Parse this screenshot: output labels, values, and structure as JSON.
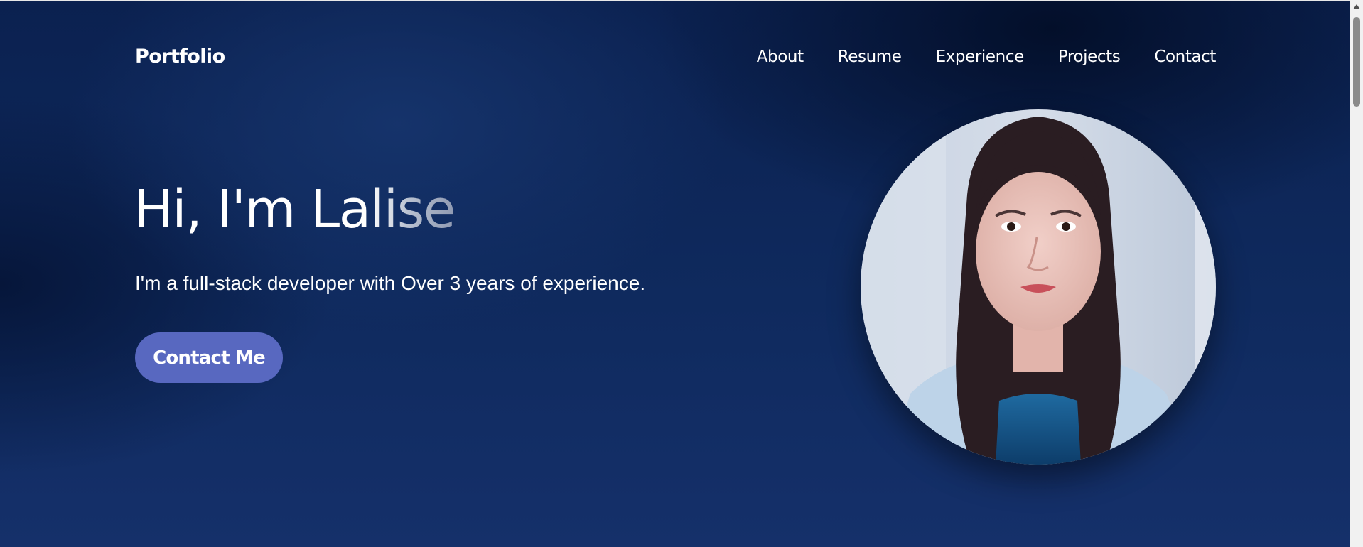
{
  "brand": "Portfolio",
  "nav": {
    "items": [
      "About",
      "Resume",
      "Experience",
      "Projects",
      "Contact"
    ]
  },
  "hero": {
    "title": "Hi, I'm Lalise",
    "subtitle": "I'm a full-stack developer with Over 3 years of experience.",
    "cta_label": "Contact Me"
  },
  "colors": {
    "background": "#0f2a5e",
    "cta": "#5868c0",
    "text": "#ffffff"
  },
  "icons": [
    "scroll-up-arrow-icon"
  ]
}
